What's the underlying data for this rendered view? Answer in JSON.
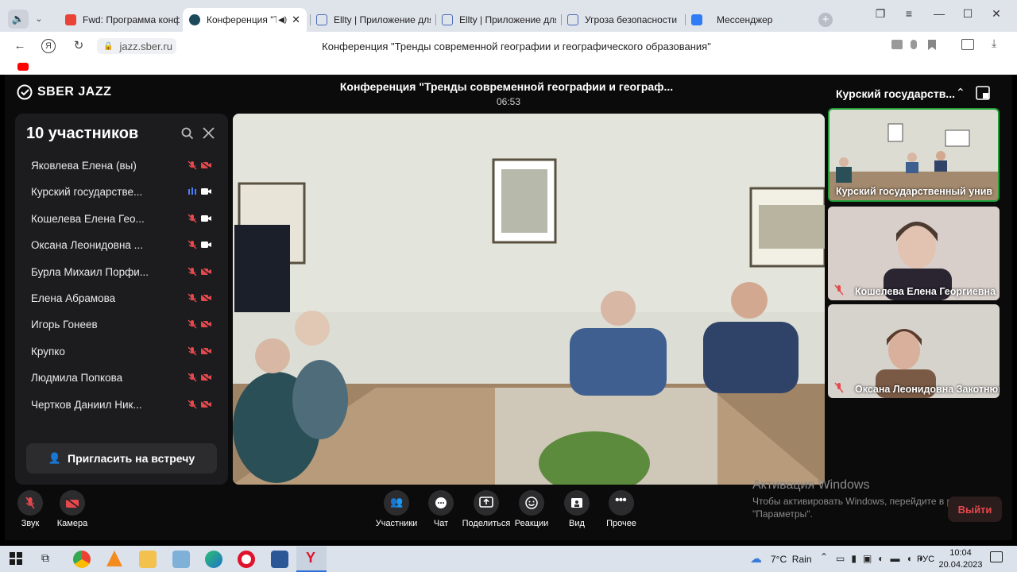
{
  "browser": {
    "tabs": [
      {
        "title": "Fwd: Программа конфе",
        "color": "#ea4335"
      },
      {
        "title": "Конференция \"Трен",
        "color": "#1c4a5a"
      },
      {
        "title": "Ellty | Приложение для",
        "color": "#4b6cb7"
      },
      {
        "title": "Ellty | Приложение для",
        "color": "#4b6cb7"
      },
      {
        "title": "Угроза безопасности",
        "color": "#4b6cb7"
      },
      {
        "title": "Мессенджер",
        "color": "#2f7cf6"
      }
    ],
    "address": "jazz.sber.ru",
    "page_title": "Конференция \"Тренды современной географии и географического образования\""
  },
  "app": {
    "brand": "SBER JAZZ",
    "meeting_title": "Конференция \"Тренды современной географии и географ...",
    "timer": "06:53",
    "participants_heading": "10 участников",
    "participants": [
      {
        "name": "Яковлева Елена (вы)",
        "mic": "off",
        "cam": "off"
      },
      {
        "name": "Курский государстве...",
        "mic": "speaking",
        "cam": "on"
      },
      {
        "name": "Кошелева Елена Гео...",
        "mic": "off",
        "cam": "on"
      },
      {
        "name": "Оксана Леонидовна ...",
        "mic": "off",
        "cam": "on"
      },
      {
        "name": "Бурла Михаил Порфи...",
        "mic": "off",
        "cam": "off"
      },
      {
        "name": "Елена Абрамова",
        "mic": "off",
        "cam": "off"
      },
      {
        "name": "Игорь Гонеев",
        "mic": "off",
        "cam": "off"
      },
      {
        "name": "Крупко",
        "mic": "off",
        "cam": "off"
      },
      {
        "name": "Людмила Попкова",
        "mic": "off",
        "cam": "off"
      },
      {
        "name": "Чертков Даниил Ник...",
        "mic": "off",
        "cam": "off"
      }
    ],
    "invite_label": "Пригласить на встречу",
    "speaker_view_title": "Курский государств...",
    "thumbnails": [
      {
        "label": "Курский государственный унив"
      },
      {
        "label": "Кошелева Елена Георгиевна"
      },
      {
        "label": "Оксана Леонидовна Закотнюк"
      }
    ],
    "controls": {
      "sound": "Звук",
      "camera": "Камера",
      "participants": "Участники",
      "chat": "Чат",
      "share": "Поделиться",
      "reactions": "Реакции",
      "view": "Вид",
      "more": "Прочее",
      "leave": "Выйти"
    },
    "activation": {
      "title": "Активация Windows",
      "line1": "Чтобы активировать Windows, перейдите в раздел",
      "line2": "\"Параметры\"."
    }
  },
  "taskbar": {
    "weather": "7°C  Rain",
    "lang": "РУС",
    "time": "10:04",
    "date": "20.04.2023"
  },
  "colors": {
    "accent_green": "#21a038",
    "muted_red": "#e5484d",
    "speaking_blue": "#4d7cff"
  }
}
